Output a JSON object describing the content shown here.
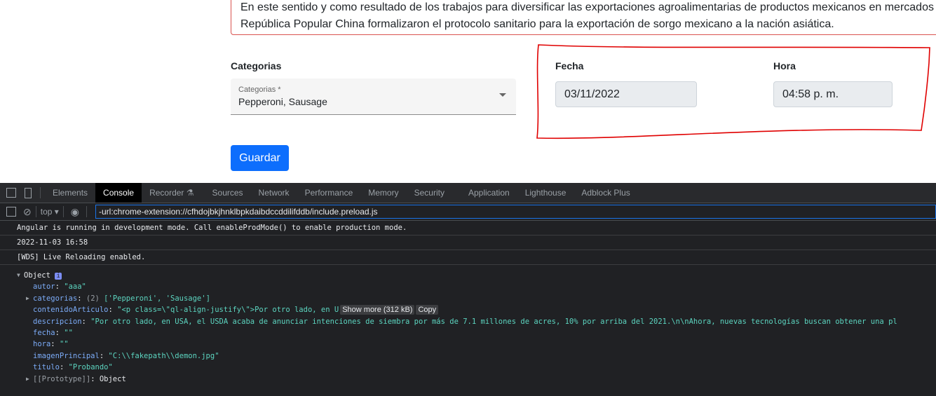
{
  "form": {
    "article_lines": [
      "En este sentido y como resultado de los trabajos para diversificar las exportaciones agroalimentarias de productos mexicanos en mercados",
      "República Popular China formalizaron el protocolo sanitario para la exportación de sorgo mexicano a la nación asiática."
    ],
    "categorias_label": "Categorias",
    "categorias_float_label": "Categorias *",
    "categorias_value": "Pepperoni, Sausage",
    "fecha_label": "Fecha",
    "fecha_value": "03/11/2022",
    "hora_label": "Hora",
    "hora_value": "04:58 p. m.",
    "save_label": "Guardar"
  },
  "devtools": {
    "tabs": [
      "Elements",
      "Console",
      "Recorder ⚗",
      "Sources",
      "Network",
      "Performance",
      "Memory",
      "Security",
      "Application",
      "Lighthouse",
      "Adblock Plus"
    ],
    "active_tab": "Console",
    "context": "top ▾",
    "filter_value": "-url:chrome-extension://cfhdojbkjhnklbpkdaibdccddilifddb/include.preload.js",
    "messages": [
      "Angular is running in development mode. Call enableProdMode() to enable production mode.",
      "2022-11-03 16:58",
      "[WDS] Live Reloading enabled."
    ],
    "object": {
      "label": "Object",
      "info": "i",
      "autor": "\"aaa\"",
      "categorias_count": "(2)",
      "categorias": "['Pepperoni', 'Sausage']",
      "contenidoArticulo": "\"<p class=\\\"ql-align-justify\\\">Por otro lado, en U",
      "show_more": "Show more (312 kB)",
      "copy": "Copy",
      "descripcion": "\"Por otro lado, en USA, el USDA acaba de anunciar intenciones de siembra por más de 7.1 millones de acres, 10% por arriba del 2021.\\n\\nAhora, nuevas tecnologías buscan obtener una pl",
      "fecha": "\"\"",
      "hora": "\"\"",
      "imagenPrincipal": "\"C:\\\\fakepath\\\\demon.jpg\"",
      "titulo": "\"Probando\"",
      "prototype_key": "[[Prototype]]",
      "prototype_val": "Object"
    }
  },
  "colors": {
    "annotation": "#e00000",
    "primary": "#0d6efd",
    "console_key": "#7cacf8",
    "console_string": "#5cd5c0"
  }
}
